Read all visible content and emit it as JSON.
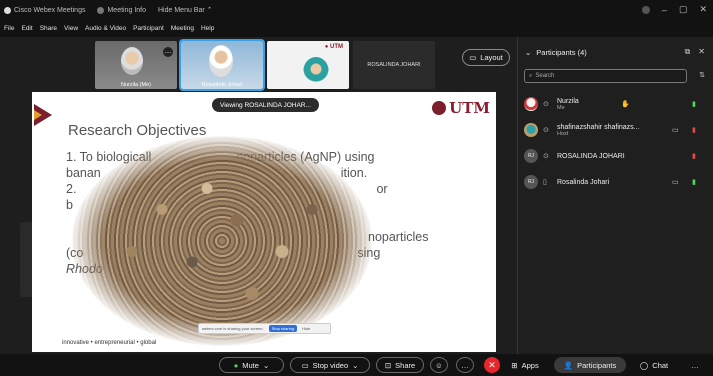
{
  "titlebar": {
    "app_name": "Cisco Webex Meetings",
    "meeting_info": "Meeting Info",
    "hide_menu": "Hide Menu Bar ⌃"
  },
  "menu": [
    "File",
    "Edit",
    "Share",
    "View",
    "Audio & Video",
    "Participant",
    "Meeting",
    "Help"
  ],
  "thumbnails": {
    "t1_label": "Nurzila (Me)",
    "t2_label": "Rosalinda Johari",
    "t4_name": "ROSALINDA JOHARI"
  },
  "layout_label": "Layout",
  "viewing": "Viewing ROSALINDA JOHAR...",
  "slide": {
    "title": "Research Objectives",
    "logo": "UTM",
    "line1": "1. To biologicall",
    "line1b": "noparticles (AgNP) using",
    "line2": "banan",
    "line2b": "ition.",
    "line3": "2.",
    "line3b": "or",
    "line4": "b",
    "line5": "noparticles",
    "line6": "(co",
    "line6b": "sing",
    "line7": "Rhodo",
    "footer": "innovative • entrepreneurial • global",
    "share_notice": "webex.com is sharing your screen.",
    "stop_sharing": "Stop sharing",
    "hide": "Hide"
  },
  "panel": {
    "title": "Participants (4)",
    "search_placeholder": "Search",
    "participants": [
      {
        "name": "Nurzila",
        "role": "Me",
        "initials": ""
      },
      {
        "name": "shafinazshahir shafinazs...",
        "role": "Host",
        "initials": ""
      },
      {
        "name": "ROSALINDA JOHARI",
        "role": "",
        "initials": "RJ"
      },
      {
        "name": "Rosalinda Johari",
        "role": "",
        "initials": "RJ"
      }
    ]
  },
  "controls": {
    "mute": "Mute",
    "stop_video": "Stop video",
    "share": "Share",
    "apps": "Apps",
    "participants": "Participants",
    "chat": "Chat"
  },
  "colors": {
    "accent": "#3aa0e6",
    "end": "#e8262b",
    "utm": "#8b1e2c",
    "mic_on": "#4cd964",
    "mic_off": "#e14b4b"
  }
}
